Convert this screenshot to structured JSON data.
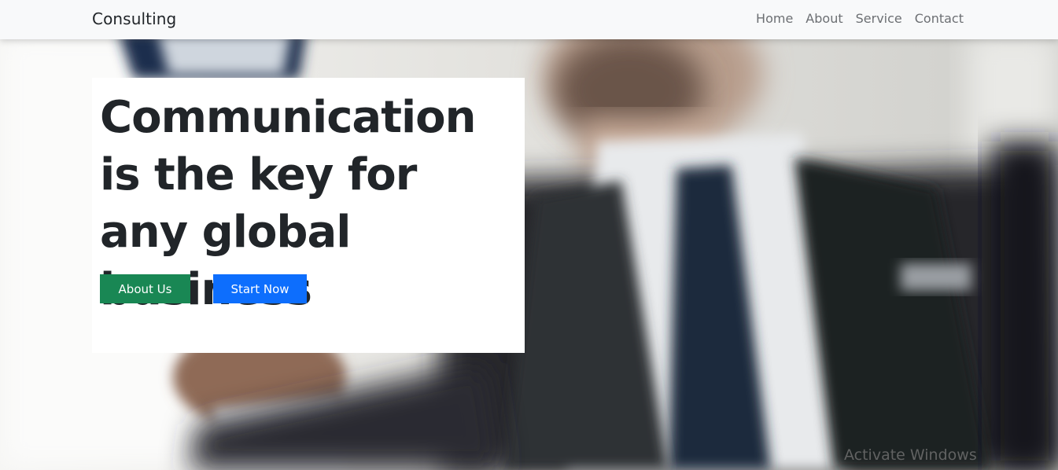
{
  "navbar": {
    "brand": "Consulting",
    "links": [
      {
        "label": "Home"
      },
      {
        "label": "About"
      },
      {
        "label": "Service"
      },
      {
        "label": "Contact"
      }
    ]
  },
  "hero": {
    "title": "Communication is the key for any global business",
    "buttons": {
      "about_label": "About Us",
      "start_label": "Start Now"
    }
  },
  "watermark": {
    "text": "Activate Windows"
  },
  "colors": {
    "navbar_bg": "#f8f9fa",
    "about_button": "#198754",
    "start_button": "#0d6efd",
    "title_text": "#212529"
  }
}
